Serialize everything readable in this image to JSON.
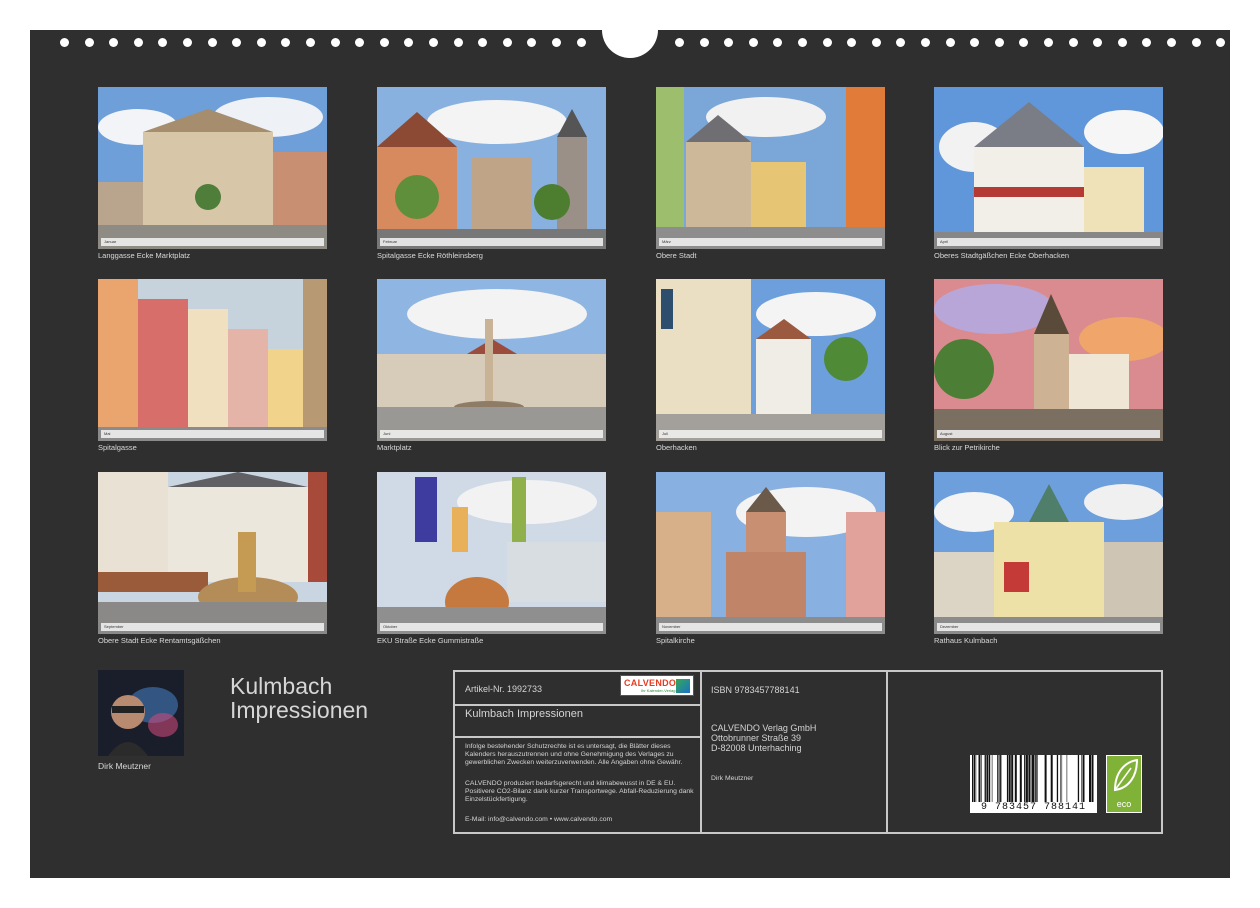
{
  "calendar": {
    "title": "Kulmbach\nImpressionen",
    "author": "Dirk Meutzner"
  },
  "photos": [
    {
      "caption": "Langgasse Ecke Marktplatz",
      "month": "Januar"
    },
    {
      "caption": "Spitalgasse Ecke Röthleinsberg",
      "month": "Februar"
    },
    {
      "caption": "Obere Stadt",
      "month": "März"
    },
    {
      "caption": "Oberes Stadtgäßchen Ecke Oberhacken",
      "month": "April"
    },
    {
      "caption": "Spitalgasse",
      "month": "Mai"
    },
    {
      "caption": "Marktplatz",
      "month": "Juni"
    },
    {
      "caption": "Oberhacken",
      "month": "Juli"
    },
    {
      "caption": "Blick zur Petrikirche",
      "month": "August"
    },
    {
      "caption": "Obere Stadt Ecke Rentamtsgäßchen",
      "month": "September"
    },
    {
      "caption": "EKU Straße Ecke Gummistraße",
      "month": "Oktober"
    },
    {
      "caption": "Spitalkirche",
      "month": "November"
    },
    {
      "caption": "Rathaus Kulmbach",
      "month": "Dezember"
    }
  ],
  "info": {
    "article": "Artikel-Nr. 1992733",
    "logo": "CALVENDO",
    "logo_sub": "Ihr Kalender-Verlag",
    "product_title": "Kulmbach Impressionen",
    "legal_1": "Infolge bestehender Schutzrechte ist es untersagt, die Blätter dieses Kalenders herauszutrennen und ohne Genehmigung des Verlages zu gewerblichen Zwecken weiterzuverwenden. Alle Angaben ohne Gewähr.",
    "legal_2": "CALVENDO produziert bedarfsgerecht und klimabewusst in DE & EU. Positivere CO2-Bilanz dank kurzer Transportwege. Abfall-Reduzierung dank Einzelstückfertigung.",
    "contact": "E-Mail: info@calvendo.com • www.calvendo.com",
    "isbn": "ISBN 9783457788141",
    "publisher_name": "CALVENDO Verlag GmbH",
    "publisher_street": "Ottobrunner Straße 39",
    "publisher_city": "D-82008 Unterhaching",
    "author": "Dirk Meutzner",
    "barcode_digits": "9 783457 788141",
    "eco_label": "eco"
  },
  "colors": {
    "background": "#2f2f2f",
    "text": "#d9d9d9",
    "eco_green": "#7fb236",
    "logo_red": "#e63b1f"
  }
}
